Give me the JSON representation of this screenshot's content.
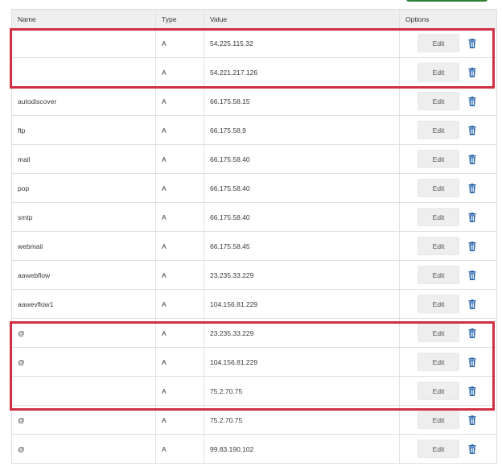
{
  "table": {
    "headers": {
      "name": "Name",
      "type": "Type",
      "value": "Value",
      "options": "Options"
    },
    "edit_label": "Edit",
    "rows": [
      {
        "name": "",
        "type": "A",
        "value": "54.225.115.32"
      },
      {
        "name": "",
        "type": "A",
        "value": "54.221.217.126"
      },
      {
        "name": "autodiscover",
        "type": "A",
        "value": "66.175.58.15"
      },
      {
        "name": "ftp",
        "type": "A",
        "value": "66.175.58.9"
      },
      {
        "name": "mail",
        "type": "A",
        "value": "66.175.58.40"
      },
      {
        "name": "pop",
        "type": "A",
        "value": "66.175.58.40"
      },
      {
        "name": "smtp",
        "type": "A",
        "value": "66.175.58.40"
      },
      {
        "name": "webmail",
        "type": "A",
        "value": "66.175.58.45"
      },
      {
        "name": "aawebflow",
        "type": "A",
        "value": "23.235.33.229"
      },
      {
        "name": "aawevflow1",
        "type": "A",
        "value": "104.156.81.229"
      },
      {
        "name": "@",
        "type": "A",
        "value": "23.235.33.229"
      },
      {
        "name": "@",
        "type": "A",
        "value": "104.156.81.229"
      },
      {
        "name": "",
        "type": "A",
        "value": "75.2.70.75"
      },
      {
        "name": "@",
        "type": "A",
        "value": "75.2.70.75"
      },
      {
        "name": "@",
        "type": "A",
        "value": "99.83.190.102"
      }
    ]
  },
  "icons": {
    "delete": "trash-icon"
  },
  "colors": {
    "highlight": "#d32f44",
    "trash": "#1f5fa8",
    "header_bg": "#efefef",
    "edit_bg": "#eeeeee"
  }
}
